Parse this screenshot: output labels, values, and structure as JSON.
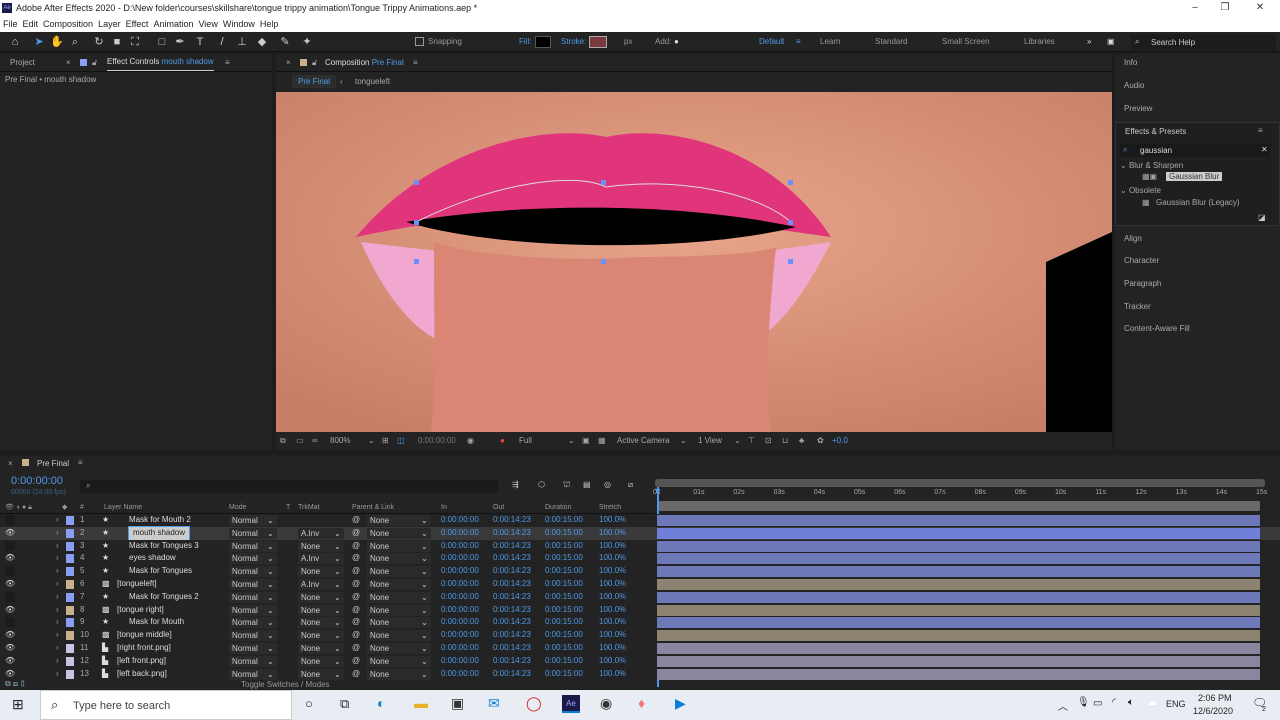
{
  "window": {
    "title": "Adobe After Effects 2020 - D:\\New folder\\courses\\skillshare\\tongue trippy animation\\Tongue Trippy Animations.aep *",
    "app_icon": "Ae"
  },
  "menu": [
    "File",
    "Edit",
    "Composition",
    "Layer",
    "Effect",
    "Animation",
    "View",
    "Window",
    "Help"
  ],
  "toolbar": {
    "snapping": "Snapping",
    "fill": "Fill:",
    "stroke": "Stroke:",
    "px": "px",
    "add": "Add:",
    "workspaces": [
      "Default",
      "Learn",
      "Standard",
      "Small Screen",
      "Libraries"
    ],
    "active_workspace": "Default",
    "more": "»",
    "search_help": "Search Help"
  },
  "left_panel": {
    "tab_project": "Project",
    "tab_effect_controls": "Effect Controls",
    "effect_layer": "mouth shadow",
    "breadcrumb": "Pre Final • mouth shadow"
  },
  "composition": {
    "tab_label": "Composition",
    "comp_name": "Pre Final",
    "subtabs": [
      "Pre Final",
      "tongueleft"
    ],
    "zoom": "800%",
    "timecode": "0:00:00:00",
    "resolution": "Full",
    "camera": "Active Camera",
    "views": "1 View",
    "exposure": "+0.0"
  },
  "right_panel": {
    "items_top": [
      "Info",
      "Audio",
      "Preview"
    ],
    "effects_title": "Effects & Presets",
    "search": "gaussian",
    "groups": [
      {
        "name": "Blur & Sharpen",
        "items": [
          "Gaussian Blur"
        ]
      },
      {
        "name": "Obsolete",
        "items": [
          "Gaussian Blur (Legacy)"
        ]
      }
    ],
    "items_bottom": [
      "Align",
      "Character",
      "Paragraph",
      "Tracker",
      "Content-Aware Fill"
    ]
  },
  "timeline": {
    "tab": "Pre Final",
    "timecode": "0:00:00:00",
    "fps": "00000 (24.00 fps)",
    "columns": {
      "layer_name": "Layer Name",
      "num": "#",
      "mode": "Mode",
      "t": "T",
      "trkmat": "TrkMat",
      "parent": "Parent & Link",
      "in": "In",
      "out": "Out",
      "duration": "Duration",
      "stretch": "Stretch"
    },
    "ruler": [
      "0s",
      "01s",
      "02s",
      "03s",
      "04s",
      "05s",
      "06s",
      "07s",
      "08s",
      "09s",
      "10s",
      "11s",
      "12s",
      "13s",
      "14s",
      "15s"
    ],
    "toggle": "Toggle Switches / Modes",
    "layers": [
      {
        "n": "1",
        "name": "Mask for Mouth 2",
        "label": "#8a9ef5",
        "trkmat": "",
        "eye": false,
        "type": "shape",
        "selected": false
      },
      {
        "n": "2",
        "name": "mouth shadow",
        "label": "#8a9ef5",
        "trkmat": "A.Inv",
        "eye": true,
        "type": "shape",
        "selected": true
      },
      {
        "n": "3",
        "name": "Mask for Tongues 3",
        "label": "#8a9ef5",
        "trkmat": "None",
        "eye": false,
        "type": "shape",
        "selected": false
      },
      {
        "n": "4",
        "name": "eyes shadow",
        "label": "#8a9ef5",
        "trkmat": "A.Inv",
        "eye": true,
        "type": "shape",
        "selected": false
      },
      {
        "n": "5",
        "name": "Mask for Tongues",
        "label": "#8a9ef5",
        "trkmat": "None",
        "eye": false,
        "type": "shape",
        "selected": false
      },
      {
        "n": "6",
        "name": "[tongueleft]",
        "label": "#c8b08a",
        "trkmat": "A.Inv",
        "eye": true,
        "type": "precomp",
        "selected": false
      },
      {
        "n": "7",
        "name": "Mask for Tongues 2",
        "label": "#8a9ef5",
        "trkmat": "None",
        "eye": false,
        "type": "shape",
        "selected": false
      },
      {
        "n": "8",
        "name": "[tongue right]",
        "label": "#c8b08a",
        "trkmat": "None",
        "eye": true,
        "type": "precomp",
        "selected": false
      },
      {
        "n": "9",
        "name": "Mask for Mouth",
        "label": "#8a9ef5",
        "trkmat": "None",
        "eye": false,
        "type": "shape",
        "selected": false
      },
      {
        "n": "10",
        "name": "[tongue middle]",
        "label": "#c8b08a",
        "trkmat": "None",
        "eye": true,
        "type": "precomp",
        "selected": false
      },
      {
        "n": "11",
        "name": "[right front.png]",
        "label": "#c9c2e0",
        "trkmat": "None",
        "eye": true,
        "type": "file",
        "selected": false
      },
      {
        "n": "12",
        "name": "[left front.png]",
        "label": "#c9c2e0",
        "trkmat": "None",
        "eye": true,
        "type": "file",
        "selected": false
      },
      {
        "n": "13",
        "name": "[left back.png]",
        "label": "#c9c2e0",
        "trkmat": "None",
        "eye": true,
        "type": "file",
        "selected": false
      }
    ],
    "mode": "Normal",
    "parent": "None",
    "in": "0:00:00:00",
    "out": "0:00:14:23",
    "duration": "0:00:15:00",
    "stretch": "100.0%"
  },
  "taskbar": {
    "search": "Type here to search",
    "lang": "ENG",
    "time": "2:06 PM",
    "date": "12/6/2020",
    "notifications": "2"
  },
  "colors": {
    "accent": "#4f9ae8",
    "panel": "#232323",
    "shape_bar": "#6c78b8",
    "precomp_bar": "#8c8470"
  }
}
